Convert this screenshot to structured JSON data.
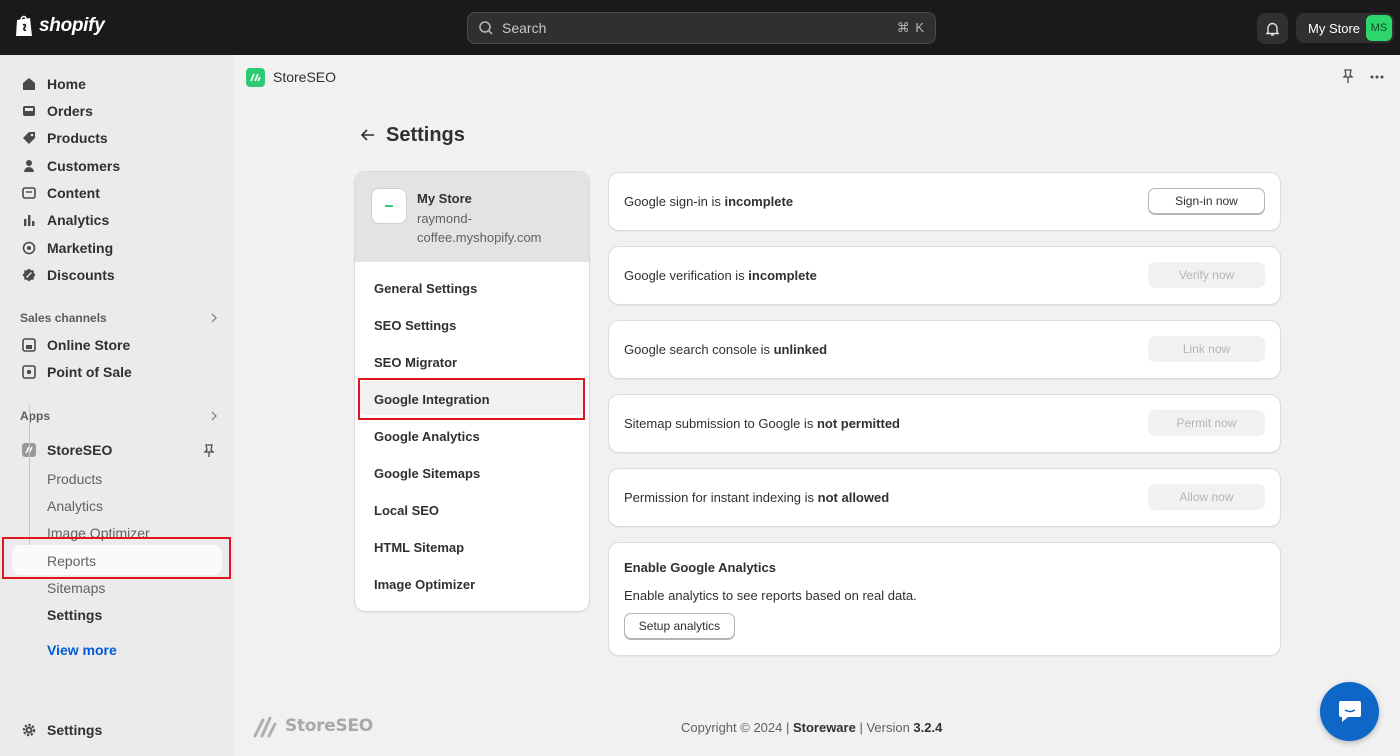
{
  "topbar": {
    "brand": "shopify",
    "search_placeholder": "Search",
    "search_shortcut": "⌘ K",
    "store_name": "My Store",
    "store_avatar": "MS"
  },
  "nav": {
    "main": [
      {
        "label": "Home",
        "icon": "home-icon"
      },
      {
        "label": "Orders",
        "icon": "orders-icon"
      },
      {
        "label": "Products",
        "icon": "tag-icon"
      },
      {
        "label": "Customers",
        "icon": "person-icon"
      },
      {
        "label": "Content",
        "icon": "content-icon"
      },
      {
        "label": "Analytics",
        "icon": "bar-chart-icon"
      },
      {
        "label": "Marketing",
        "icon": "target-icon"
      },
      {
        "label": "Discounts",
        "icon": "discount-icon"
      }
    ],
    "sales_channels_label": "Sales channels",
    "sales_channels": [
      {
        "label": "Online Store",
        "icon": "store-icon"
      },
      {
        "label": "Point of Sale",
        "icon": "pos-icon"
      }
    ],
    "apps_label": "Apps",
    "app_name": "StoreSEO",
    "app_sub": [
      "Products",
      "Analytics",
      "Image Optimizer",
      "Reports",
      "Sitemaps",
      "Settings"
    ],
    "view_more": "View more",
    "bottom_settings": "Settings"
  },
  "app_header": {
    "title": "StoreSEO"
  },
  "page": {
    "title": "Settings"
  },
  "store_card": {
    "name": "My Store",
    "domain": "raymond-coffee.myshopify.com"
  },
  "settings_menu": [
    "General Settings",
    "SEO Settings",
    "SEO Migrator",
    "Google Integration",
    "Google Analytics",
    "Google Sitemaps",
    "Local SEO",
    "HTML Sitemap",
    "Image Optimizer"
  ],
  "status_cards": [
    {
      "text": "Google sign-in is ",
      "status": "incomplete",
      "button": "Sign-in now",
      "enabled": true
    },
    {
      "text": "Google verification is ",
      "status": "incomplete",
      "button": "Verify now",
      "enabled": false
    },
    {
      "text": "Google search console is ",
      "status": "unlinked",
      "button": "Link now",
      "enabled": false
    },
    {
      "text": "Sitemap submission to Google is ",
      "status": "not permitted",
      "button": "Permit now",
      "enabled": false
    },
    {
      "text": "Permission for instant indexing is ",
      "status": "not allowed",
      "button": "Allow now",
      "enabled": false
    }
  ],
  "analytics_card": {
    "title": "Enable Google Analytics",
    "description": "Enable analytics to see reports based on real data.",
    "button": "Setup analytics"
  },
  "footer": {
    "logo_text": "StoreSEO",
    "copyright_prefix": "Copyright © 2024 | ",
    "company": "Storeware",
    "version_prefix": " | Version ",
    "version": "3.2.4"
  },
  "colors": {
    "highlight": "#e0161e",
    "brand_green": "#2dcb73",
    "link": "#005bd3",
    "chat": "#0e67c7"
  }
}
